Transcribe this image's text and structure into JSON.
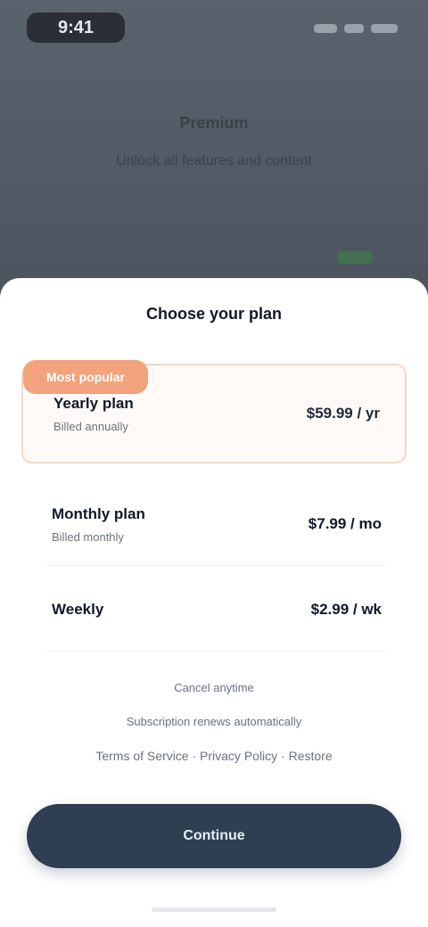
{
  "status_bar": {
    "time": "9:41"
  },
  "background_screen": {
    "title": "Premium",
    "subtitle": "Unlock all features and content"
  },
  "sheet": {
    "title": "Choose your plan",
    "badge": "Most popular",
    "plans": [
      {
        "name": "Yearly plan",
        "sub": "Billed annually",
        "price": "$59.99 / yr"
      },
      {
        "name": "Monthly plan",
        "sub": "Billed monthly",
        "price": "$7.99 / mo"
      },
      {
        "name": "Weekly",
        "sub": "",
        "price": "$2.99 / wk"
      }
    ],
    "info": [
      "Cancel anytime",
      "Subscription renews automatically",
      "Terms of Service · Privacy Policy · Restore"
    ],
    "cta": "Continue"
  },
  "colors": {
    "accent": "#f2a27c",
    "button": "#2f3e52",
    "backdrop": "#4f5863"
  }
}
